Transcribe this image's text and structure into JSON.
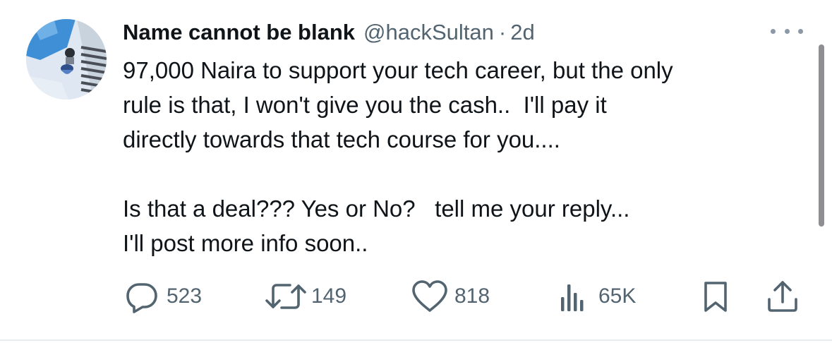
{
  "tweet": {
    "author": {
      "display_name": "Name cannot be blank",
      "handle": "@hackSultan",
      "separator": "·",
      "time": "2d"
    },
    "text_lines": [
      "97,000 Naira to support your tech career, but the only",
      "rule is that, I won't give you the cash..  I'll pay it",
      "directly towards that tech course for you....",
      "",
      "Is that a deal??? Yes or No?   tell me your reply...",
      "I'll post more info soon.."
    ],
    "actions": {
      "reply": {
        "icon": "reply-icon",
        "count": "523"
      },
      "retweet": {
        "icon": "retweet-icon",
        "count": "149"
      },
      "like": {
        "icon": "heart-icon",
        "count": "818"
      },
      "views": {
        "icon": "views-icon",
        "count": "65K"
      },
      "bookmark": {
        "icon": "bookmark-icon"
      },
      "share": {
        "icon": "share-icon"
      }
    }
  },
  "colors": {
    "text": "#0f1419",
    "secondary": "#536471",
    "more_dots": "#8b98a5"
  }
}
